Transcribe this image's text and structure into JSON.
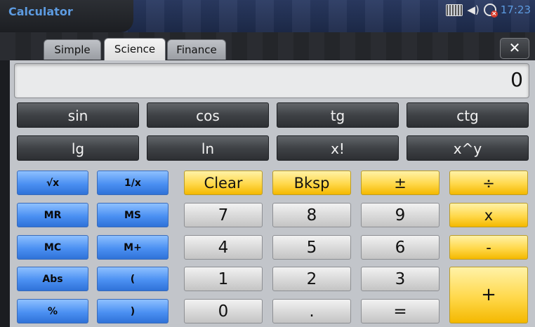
{
  "status": {
    "app_title": "Calculator",
    "time": "17:23"
  },
  "tabs": [
    {
      "label": "Simple"
    },
    {
      "label": "Science"
    },
    {
      "label": "Finance"
    }
  ],
  "display": {
    "value": "0"
  },
  "sci_row1": [
    "sin",
    "cos",
    "tg",
    "ctg"
  ],
  "sci_row2": [
    "lg",
    "ln",
    "x!",
    "x^y"
  ],
  "mem_keys": [
    "√x",
    "1/x",
    "MR",
    "MS",
    "MC",
    "M+",
    "Abs",
    "(",
    "%",
    ")"
  ],
  "ops": {
    "clear": "Clear",
    "bksp": "Bksp",
    "sign": "±",
    "div": "÷",
    "mul": "x",
    "sub": "-",
    "add": "+",
    "eq": "="
  },
  "digits": [
    "7",
    "8",
    "9",
    "4",
    "5",
    "6",
    "1",
    "2",
    "3",
    "0",
    "."
  ],
  "icons": {
    "close": "close-icon",
    "keyboard": "keyboard-icon",
    "volume": "volume-icon",
    "network": "network-error-icon"
  },
  "colors": {
    "accent": "#5d9be0",
    "mem_blue": "#4b90f2",
    "op_yellow": "#ffd84a"
  }
}
